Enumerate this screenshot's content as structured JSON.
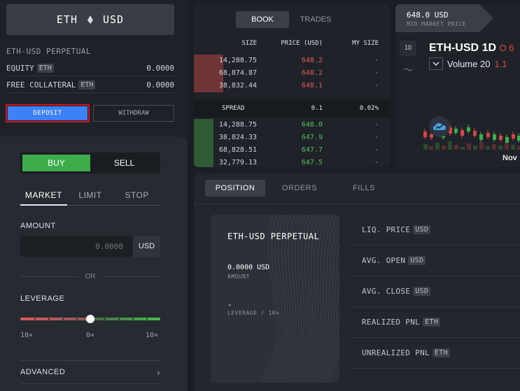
{
  "market": {
    "base": "ETH",
    "quote": "USD",
    "title": "ETH-USD PERPETUAL"
  },
  "account": {
    "equity_label": "EQUITY",
    "equity_unit": "ETH",
    "equity_value": "0.0000",
    "collateral_label": "FREE COLLATERAL",
    "collateral_unit": "ETH",
    "collateral_value": "0.0000",
    "deposit_label": "DEPOSIT",
    "withdraw_label": "WITHDRAW"
  },
  "order_form": {
    "buy_label": "BUY",
    "sell_label": "SELL",
    "types": [
      "MARKET",
      "LIMIT",
      "STOP"
    ],
    "amount_label": "AMOUNT",
    "amount_placeholder": "0.0000",
    "amount_unit": "USD",
    "or_label": "OR",
    "leverage_label": "LEVERAGE",
    "leverage_level": 0.5,
    "leverage_ticks": [
      "10×",
      "0×",
      "10×"
    ],
    "advanced_label": "ADVANCED",
    "advanced_chevron": "›"
  },
  "book": {
    "tabs": [
      "BOOK",
      "TRADES"
    ],
    "headers": {
      "size": "SIZE",
      "price": "PRICE (USD)",
      "my_size": "MY SIZE"
    },
    "asks": [
      {
        "size": "14,288.75",
        "price": "648.2",
        "my": "-",
        "depth": 0.15
      },
      {
        "size": "68,874.87",
        "price": "648.2",
        "my": "-",
        "depth": 0.15
      },
      {
        "size": "38,832.44",
        "price": "648.1",
        "my": "-",
        "depth": 0.15
      }
    ],
    "spread": {
      "label": "SPREAD",
      "value": "0.1",
      "percent": "0.02%"
    },
    "bids": [
      {
        "size": "14,288.75",
        "price": "648.0",
        "my": "-",
        "depth": 0.1
      },
      {
        "size": "38,824.33",
        "price": "647.9",
        "my": "-",
        "depth": 0.1
      },
      {
        "size": "68,828.51",
        "price": "647.7",
        "my": "-",
        "depth": 0.1
      },
      {
        "size": "32,779.13",
        "price": "647.5",
        "my": "-",
        "depth": 0.1
      }
    ]
  },
  "chart": {
    "mid_value": "648.0 USD",
    "mid_label": "MID MARKET PRICE",
    "interval": "1D",
    "line_tool": "〜",
    "symbol": "ETH-USD",
    "symbol_interval": "1D",
    "change": "O 6",
    "volume_label": "Volume 20",
    "volume_value": "1.1",
    "x_label": "Nov",
    "collapse_icon": "chevron-down-icon",
    "logo_icon": "tradingview-cloud-icon"
  },
  "positions": {
    "tabs": [
      "POSITION",
      "ORDERS",
      "FILLS"
    ],
    "card": {
      "title": "ETH-USD PERPETUAL",
      "amount": "0.0000 USD",
      "amount_label": "AMOUNT",
      "leverage": "-",
      "leverage_label": "LEVERAGE / 10×"
    },
    "stats": [
      {
        "label": "LIQ. PRICE",
        "unit": "USD"
      },
      {
        "label": "AVG. OPEN",
        "unit": "USD"
      },
      {
        "label": "AVG. CLOSE",
        "unit": "USD"
      },
      {
        "label": "REALIZED PNL",
        "unit": "ETH"
      },
      {
        "label": "UNREALIZED PNL",
        "unit": "ETH"
      }
    ]
  },
  "colors": {
    "accent": "#3b82f6",
    "buy": "#3cad4a",
    "ask": "#e65a5a",
    "bid": "#4fc159",
    "highlight": "#d5141c"
  }
}
